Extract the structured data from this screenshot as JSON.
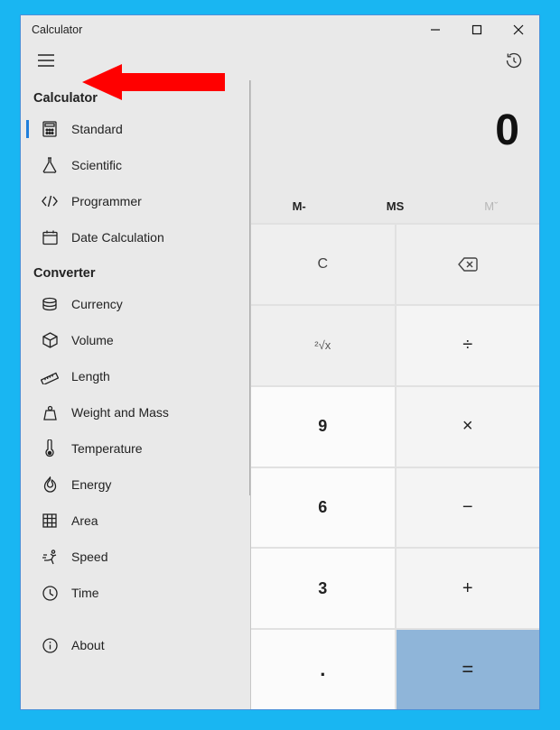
{
  "window": {
    "title": "Calculator"
  },
  "display": {
    "value": "0"
  },
  "memory": {
    "m_minus": "M-",
    "ms": "MS",
    "m_more": "Mˇ"
  },
  "nav": {
    "heading_calculator": "Calculator",
    "heading_converter": "Converter",
    "items_calculator": [
      {
        "label": "Standard",
        "icon": "calculator"
      },
      {
        "label": "Scientific",
        "icon": "flask"
      },
      {
        "label": "Programmer",
        "icon": "code"
      },
      {
        "label": "Date Calculation",
        "icon": "calendar"
      }
    ],
    "items_converter": [
      {
        "label": "Currency",
        "icon": "coins"
      },
      {
        "label": "Volume",
        "icon": "cube"
      },
      {
        "label": "Length",
        "icon": "ruler"
      },
      {
        "label": "Weight and Mass",
        "icon": "weight"
      },
      {
        "label": "Temperature",
        "icon": "thermometer"
      },
      {
        "label": "Energy",
        "icon": "flame"
      },
      {
        "label": "Area",
        "icon": "grid"
      },
      {
        "label": "Speed",
        "icon": "runner"
      },
      {
        "label": "Time",
        "icon": "clock"
      }
    ],
    "about": "About"
  },
  "keys": {
    "clear": "C",
    "root": "²√x",
    "divide": "÷",
    "nine": "9",
    "times": "×",
    "six": "6",
    "minus": "−",
    "three": "3",
    "plus": "+",
    "dot": ".",
    "equals": "="
  }
}
